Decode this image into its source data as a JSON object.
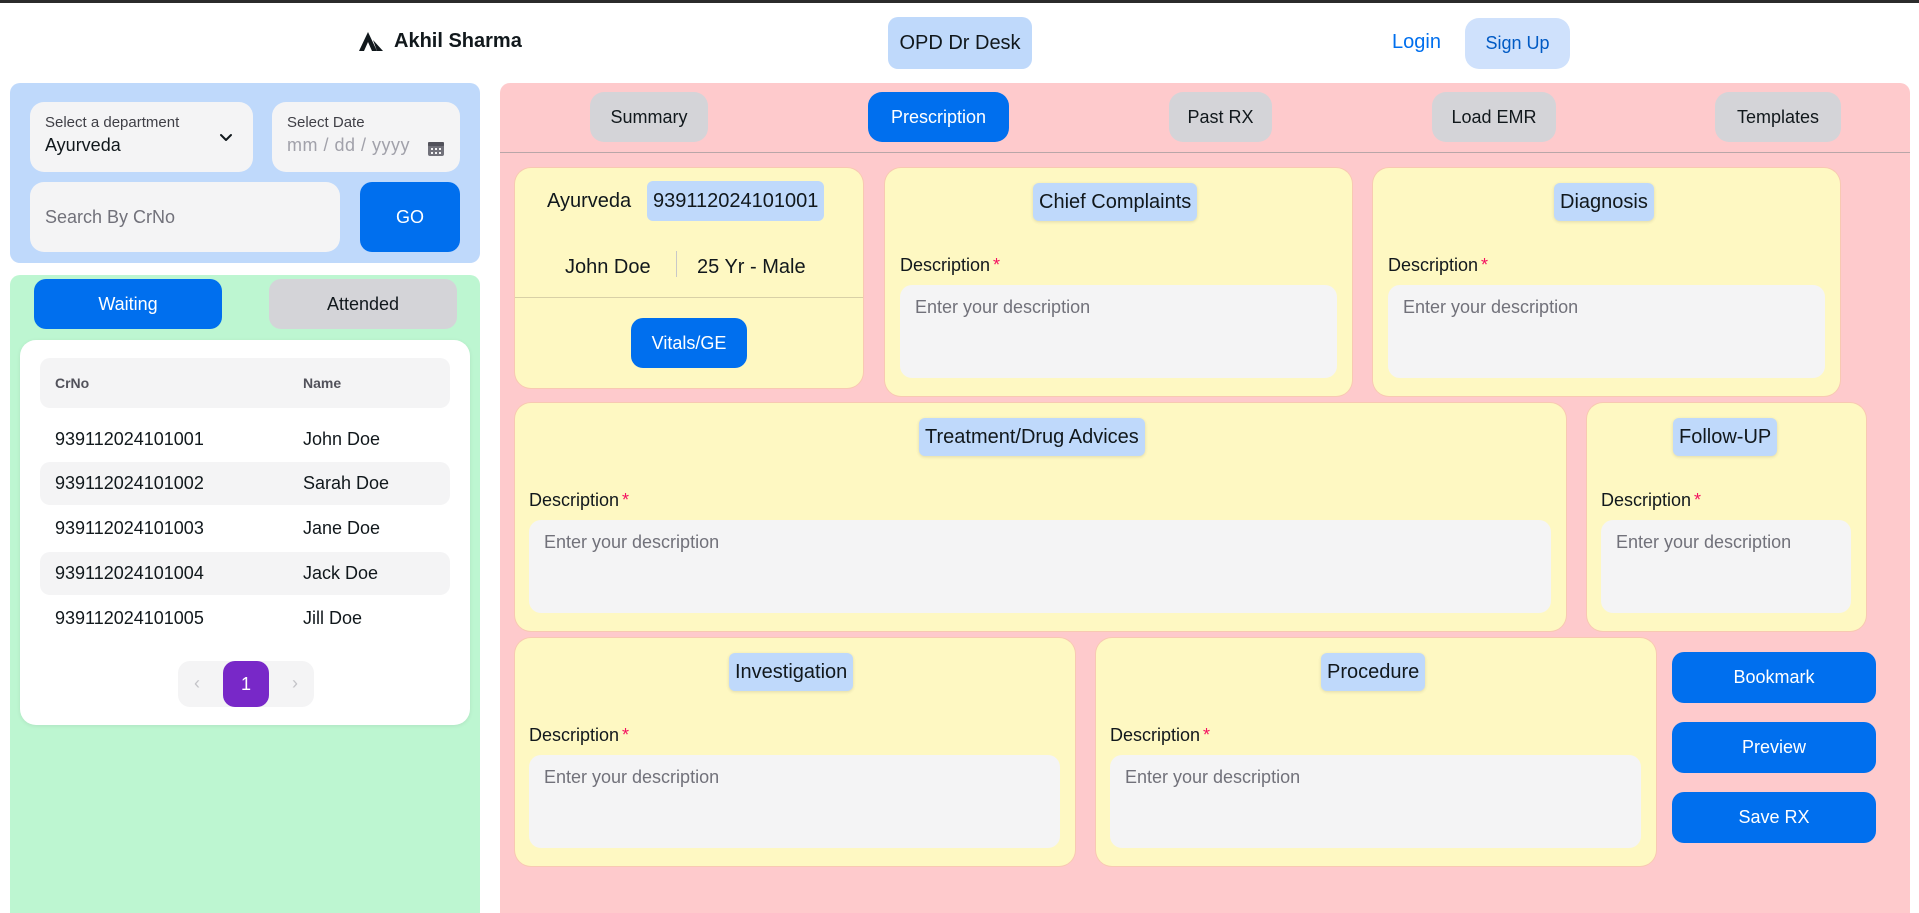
{
  "header": {
    "brand_name": "Akhil Sharma",
    "app_title": "OPD Dr Desk",
    "login_label": "Login",
    "signup_label": "Sign Up"
  },
  "filters": {
    "department_label": "Select a department",
    "department_value": "Ayurveda",
    "date_label": "Select Date",
    "date_placeholder": "mm / dd / yyyy",
    "search_placeholder": "Search By CrNo",
    "go_label": "GO"
  },
  "queue": {
    "tabs": [
      {
        "label": "Waiting",
        "active": true
      },
      {
        "label": "Attended",
        "active": false
      }
    ],
    "columns": [
      "CrNo",
      "Name"
    ],
    "rows": [
      {
        "crno": "939112024101001",
        "name": "John Doe"
      },
      {
        "crno": "939112024101002",
        "name": "Sarah Doe"
      },
      {
        "crno": "939112024101003",
        "name": "Jane Doe"
      },
      {
        "crno": "939112024101004",
        "name": "Jack Doe"
      },
      {
        "crno": "939112024101005",
        "name": "Jill Doe"
      }
    ],
    "pagination": {
      "prev": "‹",
      "current": "1",
      "next": "›"
    }
  },
  "tabs": [
    {
      "label": "Summary",
      "active": false
    },
    {
      "label": "Prescription",
      "active": true
    },
    {
      "label": "Past RX",
      "active": false
    },
    {
      "label": "Load EMR",
      "active": false
    },
    {
      "label": "Templates",
      "active": false
    }
  ],
  "patient": {
    "department": "Ayurveda",
    "crno": "939112024101001",
    "name": "John Doe",
    "age_sex": "25 Yr - Male",
    "vitals_label": "Vitals/GE"
  },
  "sections": {
    "description_label": "Description",
    "required_mark": "*",
    "placeholder": "Enter your description",
    "chief_complaints": "Chief Complaints",
    "diagnosis": "Diagnosis",
    "treatment": "Treatment/Drug Advices",
    "follow_up": "Follow-UP",
    "investigation": "Investigation",
    "procedure": "Procedure"
  },
  "actions": {
    "bookmark": "Bookmark",
    "preview": "Preview",
    "save": "Save RX"
  },
  "colors": {
    "accent": "#006fee",
    "filter_panel": "#bfd9fb",
    "queue_panel": "#bdf6d1",
    "main_panel": "#fecacc",
    "card": "#fef8c2",
    "pagination_active": "#7828c8"
  }
}
